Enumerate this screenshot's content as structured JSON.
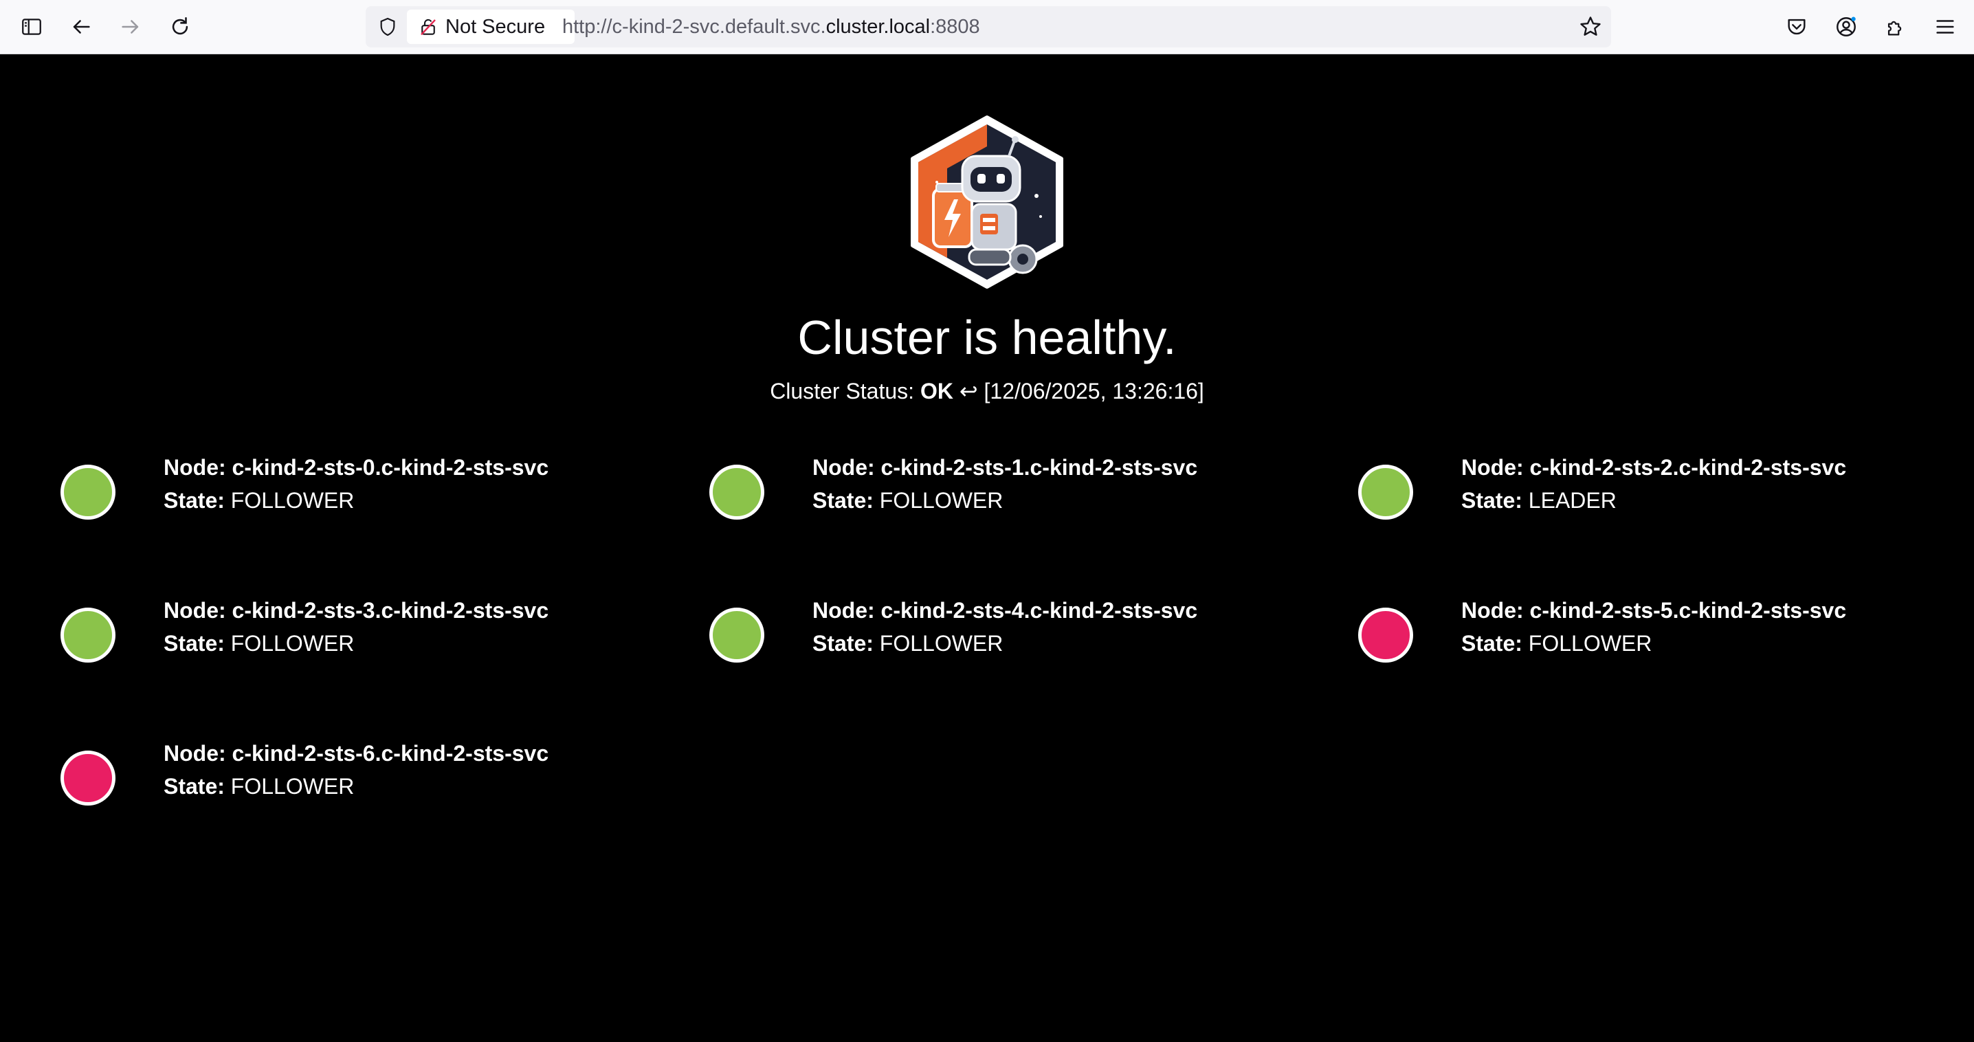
{
  "browser": {
    "security_label": "Not Secure",
    "url_prefix": "http://c-kind-2-svc.default.svc.",
    "url_host": "cluster.local",
    "url_suffix": ":8808"
  },
  "page": {
    "headline": "Cluster is healthy.",
    "status_label": "Cluster Status:",
    "status_value": "OK",
    "status_icon": "↩",
    "timestamp": "[12/06/2025, 13:26:16]",
    "node_prefix": "Node:",
    "state_prefix": "State:"
  },
  "colors": {
    "healthy": "#8bc34a",
    "unhealthy": "#e91e63"
  },
  "nodes": [
    {
      "name": "c-kind-2-sts-0.c-kind-2-sts-svc",
      "state": "FOLLOWER",
      "health": "healthy"
    },
    {
      "name": "c-kind-2-sts-1.c-kind-2-sts-svc",
      "state": "FOLLOWER",
      "health": "healthy"
    },
    {
      "name": "c-kind-2-sts-2.c-kind-2-sts-svc",
      "state": "LEADER",
      "health": "healthy"
    },
    {
      "name": "c-kind-2-sts-3.c-kind-2-sts-svc",
      "state": "FOLLOWER",
      "health": "healthy"
    },
    {
      "name": "c-kind-2-sts-4.c-kind-2-sts-svc",
      "state": "FOLLOWER",
      "health": "healthy"
    },
    {
      "name": "c-kind-2-sts-5.c-kind-2-sts-svc",
      "state": "FOLLOWER",
      "health": "unhealthy"
    },
    {
      "name": "c-kind-2-sts-6.c-kind-2-sts-svc",
      "state": "FOLLOWER",
      "health": "unhealthy"
    }
  ]
}
